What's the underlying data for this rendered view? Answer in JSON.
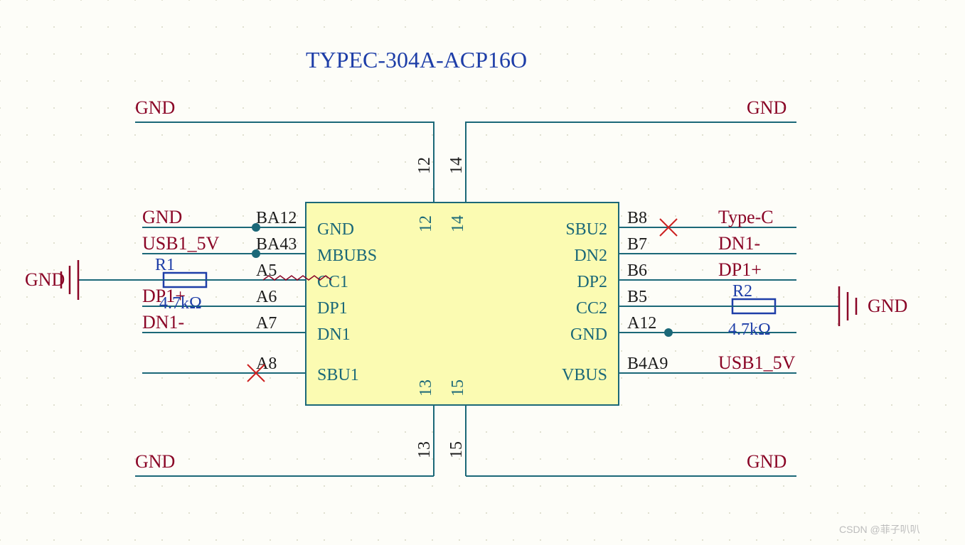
{
  "title": "TYPEC-304A-ACP16O",
  "watermark": "CSDN @菲子叭叭",
  "ic": {
    "left_pins": [
      {
        "num_text": "BA12",
        "name": "GND"
      },
      {
        "num_text": "BA43",
        "name": "MBUBS"
      },
      {
        "num_text": "A5",
        "name": "CC1"
      },
      {
        "num_text": "A6",
        "name": "DP1"
      },
      {
        "num_text": "A7",
        "name": "DN1"
      },
      {
        "num_text": "A8",
        "name": "SBU1"
      }
    ],
    "right_pins": [
      {
        "num_text": "B8",
        "name": "SBU2"
      },
      {
        "num_text": "B7",
        "name": "DN2"
      },
      {
        "num_text": "B6",
        "name": "DP2"
      },
      {
        "num_text": "B5",
        "name": "CC2"
      },
      {
        "num_text": "A12",
        "name": "GND"
      },
      {
        "num_text": "B4A9",
        "name": "VBUS"
      }
    ],
    "top_pins": [
      {
        "num": "12",
        "name": "12"
      },
      {
        "num": "14",
        "name": "14"
      }
    ],
    "bottom_pins": [
      {
        "num": "13",
        "name": "13"
      },
      {
        "num": "15",
        "name": "15"
      }
    ]
  },
  "nets": {
    "top_left": "GND",
    "top_right": "GND",
    "bottom_left": "GND",
    "bottom_right": "GND",
    "left_labels": [
      "GND",
      "USB1_5V",
      "",
      "DP1+",
      "DN1-",
      ""
    ],
    "right_labels": [
      "Type-C",
      "DN1-",
      "DP1+",
      "",
      "",
      "USB1_5V"
    ],
    "r_presence": [
      false,
      false,
      false,
      true,
      false,
      false
    ],
    "gnd_left": "GND",
    "gnd_right": "GND"
  },
  "components": {
    "r1": {
      "ref": "R1",
      "value": "4.7kΩ"
    },
    "r2": {
      "ref": "R2",
      "value": "4.7kΩ"
    }
  }
}
